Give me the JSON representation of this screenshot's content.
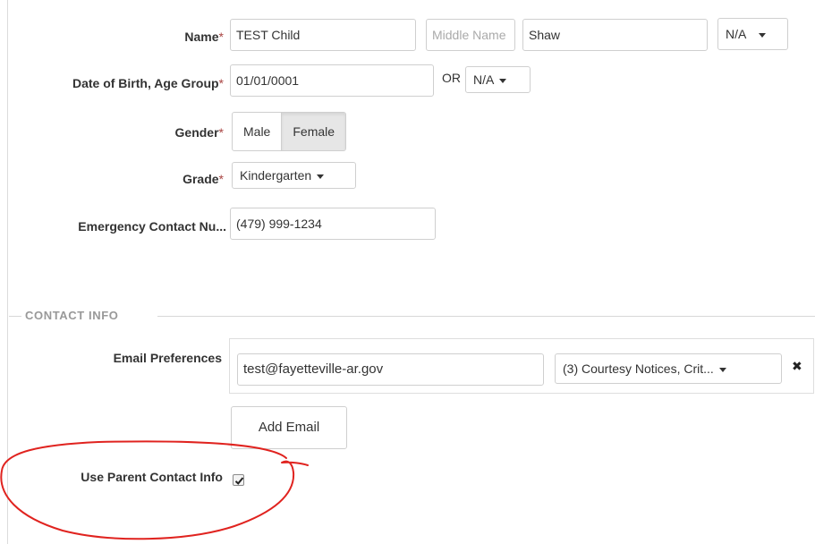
{
  "child_form": {
    "name_label": "Name",
    "required_mark": "*",
    "first_name": "TEST Child",
    "middle_name_placeholder": "Middle Name",
    "last_name": "Shaw",
    "suffix": "N/A",
    "dob_label": "Date of Birth, Age Group",
    "dob_value": "01/01/0001",
    "or_label": "OR",
    "age_group": "N/A",
    "gender_label": "Gender",
    "gender_options": [
      "Male",
      "Female"
    ],
    "gender_selected": "Female",
    "grade_label": "Grade",
    "grade_value": "Kindergarten",
    "emergency_label": "Emergency Contact Nu...",
    "emergency_value": "(479) 999-1234"
  },
  "contact_info": {
    "section_title": "CONTACT INFO",
    "email_pref_label": "Email Preferences",
    "email_value": "test@fayetteville-ar.gov",
    "email_pref_select": "(3) Courtesy Notices, Crit...",
    "remove_glyph": "✖",
    "add_email_label": "Add Email",
    "use_parent_label": "Use Parent Contact Info",
    "use_parent_checked": true
  },
  "annotation": {
    "color": "#e0231f",
    "shape": "red hand-drawn circle around Use Parent Contact Info"
  },
  "colors": {
    "required": "#a94442",
    "border": "#cfcfcf",
    "section_text": "#999999"
  }
}
